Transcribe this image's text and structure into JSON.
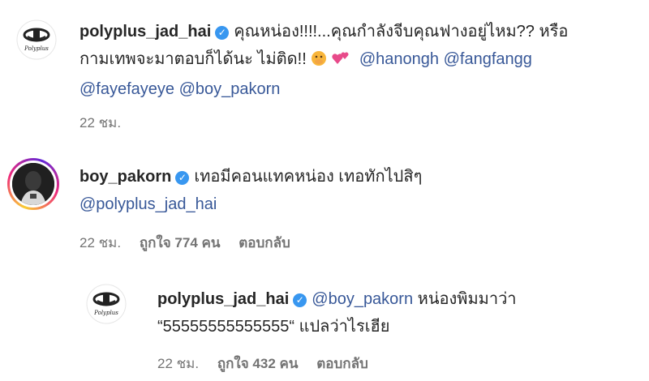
{
  "comments": [
    {
      "username": "polyplus_jad_hai",
      "text_parts": [
        "คุณหน่อง!!!!...คุณกำลังจีบคุณฟางอยู่ไหม?? หรือ",
        "กามเทพจะมาตอบก็ได้นะ ไม่ติด!! "
      ],
      "mentions": [
        "@hanongh",
        "@fangfangg",
        "@fayefayeye",
        "@boy_pakorn"
      ],
      "emojis": [
        "hand-over-mouth-emoji",
        "two-hearts-emoji"
      ],
      "time": "22 ชม."
    },
    {
      "username": "boy_pakorn",
      "text": "เทอมีคอนแทคหน่อง เทอทักไปสิๆ",
      "mention": "@polyplus_jad_hai",
      "time": "22 ชม.",
      "likes": "ถูกใจ 774 คน",
      "reply_label": "ตอบกลับ"
    },
    {
      "username": "polyplus_jad_hai",
      "mention": "@boy_pakorn",
      "text_line1": " หน่องพิมมาว่า",
      "text_line2": "“55555555555555“ แปลว่าไรเฮีย",
      "time": "22 ชม.",
      "likes": "ถูกใจ 432 คน",
      "reply_label": "ตอบกลับ"
    }
  ],
  "logo_text": "Polyplus"
}
